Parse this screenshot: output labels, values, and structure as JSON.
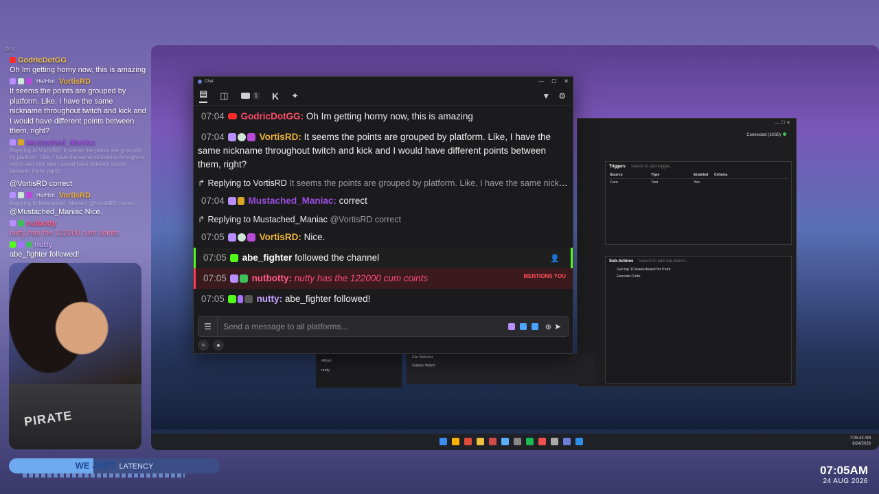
{
  "overlay": {
    "partial_top": "bru",
    "messages": [
      {
        "name": "GodricDotGG",
        "text": "Oh Im getting horny now, this is amazing"
      },
      {
        "pronoun": "He/Him",
        "name": "VortisRD",
        "text": "It seems the points are grouped by platform. Like, I have the same nickname throughout twitch and kick and I would have different points between them, right?"
      },
      {
        "name": "Mustached_Maniac",
        "text": "Replying to VortisRD: It seems the points are grouped by platform. Like, I have the same nickname throughout twitch and kick and I would have different points between them, right?"
      },
      {
        "text": "@VortisRD correct"
      },
      {
        "pronoun": "He/Him",
        "name": "VortisRD",
        "reply": "Replying to Mustached_Maniac: @VortisRD correct",
        "text": "@Mustached_Maniac Nice."
      },
      {
        "name": "nutbotty",
        "text": "nutty has the 122000 cum coints"
      },
      {
        "name": "nutty",
        "text": "abe_fighter followed!"
      }
    ]
  },
  "subbar": {
    "bold": "WE JUST",
    "label": "LATENCY",
    "progress": 0.4
  },
  "clock": {
    "time": "07:05AM",
    "date": "24 AUG 2026"
  },
  "bgapp": {
    "connection": "Connected (10/10)",
    "triggers": {
      "title": "Triggers",
      "search_placeholder": "Search to add trigger...",
      "columns": [
        "Source",
        "Type",
        "Enabled",
        "Criteria"
      ],
      "rows": [
        [
          "Core",
          "Test",
          "Yes",
          ""
        ]
      ]
    },
    "subactions": {
      "title": "Sub-Actions",
      "search_placeholder": "Search to add sub-action...",
      "items": [
        "Get top 10 leaderboard for Point",
        "Execute Code"
      ]
    },
    "nav": [
      "Settings",
      "About",
      "nutty"
    ],
    "mid": [
      "File Watcher",
      "Galaxy Watch"
    ]
  },
  "taskbar": {
    "time": "7:05:42 AM",
    "date": "8/24/2026"
  },
  "chat": {
    "window_title": "Chat",
    "youtube_count": "1",
    "messages": [
      {
        "ts": "07:04",
        "name": "GodricDotGG",
        "sep": ":",
        "text": " Oh Im getting horny now, this is amazing"
      },
      {
        "ts": "07:04",
        "name": "VortisRD",
        "sep": ":",
        "text": " It seems the points are grouped by platform. Like, I have the same nickname throughout twitch and kick and I would have different points between them, right?"
      },
      {
        "reply_label": "Replying to VortisRD",
        "reply_text": " It seems the points are grouped by platform. Like, I have the same nickname throughout twitch and kick and I would have different points between them, right?"
      },
      {
        "ts": "07:04",
        "name": "Mustached_Maniac",
        "sep": ":",
        "text": "  correct"
      },
      {
        "reply_label": "Replying to Mustached_Maniac",
        "reply_text": " @VortisRD correct"
      },
      {
        "ts": "07:05",
        "name": "VortisRD",
        "sep": ":",
        "text": "  Nice."
      },
      {
        "ts": "07:05",
        "name": "abe_fighter",
        "text": " followed the channel"
      },
      {
        "ts": "07:05",
        "name": "nutbotty",
        "sep": ":",
        "text": " nutty has the 122000 cum coints",
        "tag": "MENTIONS YOU"
      },
      {
        "ts": "07:05",
        "name": "nutty",
        "sep": ":",
        "text": " abe_fighter followed!"
      }
    ],
    "input_placeholder": "Send a message to all platforms..."
  }
}
